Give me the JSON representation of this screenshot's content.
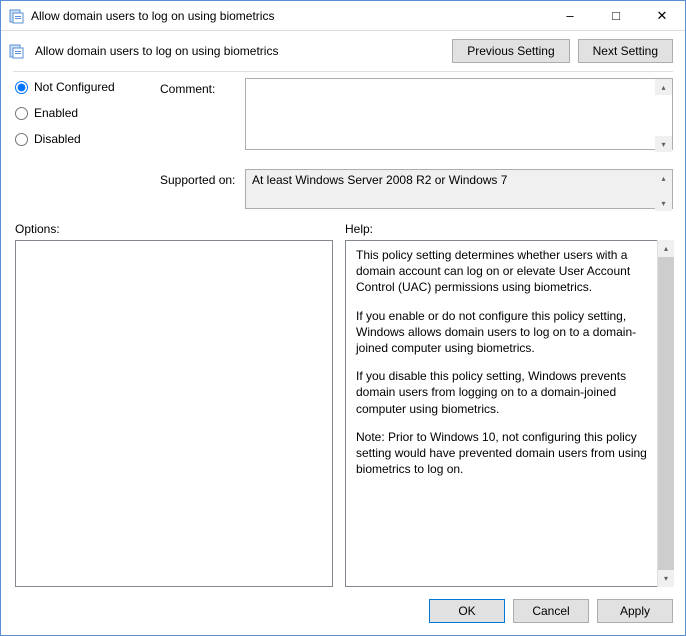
{
  "window": {
    "title": "Allow domain users to log on using biometrics"
  },
  "header": {
    "policy_name": "Allow domain users to log on using biometrics",
    "prev_btn": "Previous Setting",
    "next_btn": "Next Setting"
  },
  "state": {
    "options": {
      "not_configured": "Not Configured",
      "enabled": "Enabled",
      "disabled": "Disabled"
    },
    "selected": "not_configured"
  },
  "labels": {
    "comment": "Comment:",
    "supported_on": "Supported on:",
    "options": "Options:",
    "help": "Help:"
  },
  "fields": {
    "comment": "",
    "supported_on": "At least Windows Server 2008 R2 or Windows 7"
  },
  "help": {
    "p1": "This policy setting determines whether users with a domain account can log on or elevate User Account Control (UAC) permissions using biometrics.",
    "p2": "If you enable or do not configure this policy setting, Windows allows domain users to log on to a domain-joined computer using biometrics.",
    "p3": "If you disable this policy setting, Windows prevents domain users from logging on to a domain-joined computer using biometrics.",
    "p4": "Note: Prior to Windows 10, not configuring this policy setting would have prevented domain users from using biometrics to log on."
  },
  "footer": {
    "ok": "OK",
    "cancel": "Cancel",
    "apply": "Apply"
  }
}
